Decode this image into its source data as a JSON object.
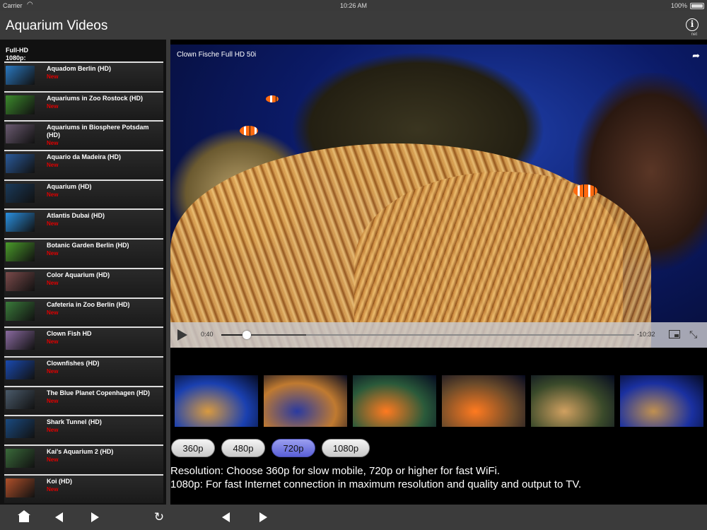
{
  "status": {
    "carrier": "Carrier",
    "time": "10:26 AM",
    "battery": "100%"
  },
  "header": {
    "title": "Aquarium Videos",
    "info_label": "net"
  },
  "sidebar": {
    "section_title": "Full-HD 1080p:",
    "items": [
      {
        "name": "Aquadom Berlin (HD)",
        "badge": "New",
        "thumb": "#2a78c0"
      },
      {
        "name": "Aquariums in Zoo Rostock (HD)",
        "badge": "New",
        "thumb": "#3c8a2c"
      },
      {
        "name": "Aquariums in Biosphere Potsdam (HD)",
        "badge": "New",
        "thumb": "#6a5a70"
      },
      {
        "name": "Aquario da Madeira (HD)",
        "badge": "New",
        "thumb": "#2a5a9a"
      },
      {
        "name": "Aquarium (HD)",
        "badge": "New",
        "thumb": "#1a3a5a"
      },
      {
        "name": "Atlantis Dubai (HD)",
        "badge": "New",
        "thumb": "#2a90e0"
      },
      {
        "name": "Botanic Garden Berlin (HD)",
        "badge": "New",
        "thumb": "#4a9a2a"
      },
      {
        "name": "Color Aquarium (HD)",
        "badge": "New",
        "thumb": "#7a4a4a"
      },
      {
        "name": "Cafeteria in Zoo Berlin (HD)",
        "badge": "New",
        "thumb": "#3a7a3a"
      },
      {
        "name": "Clown Fish HD",
        "badge": "New",
        "thumb": "#8a6aa0"
      },
      {
        "name": "Clownfishes (HD)",
        "badge": "New",
        "thumb": "#1a4ab0"
      },
      {
        "name": "The Blue Planet Copenhagen (HD)",
        "badge": "New",
        "thumb": "#4a5a6a"
      },
      {
        "name": "Shark Tunnel (HD)",
        "badge": "New",
        "thumb": "#1a4a80"
      },
      {
        "name": "Kai's Aquarium 2 (HD)",
        "badge": "New",
        "thumb": "#3a6a3a"
      },
      {
        "name": "Koi (HD)",
        "badge": "New",
        "thumb": "#b0502a"
      }
    ]
  },
  "video": {
    "title": "Clown Fische Full HD 50i",
    "elapsed": "0:40",
    "remaining": "-10:32",
    "progress_fraction": 0.062
  },
  "thumbnails": [
    {
      "color": "#1a40b0",
      "accent": "#d89a40"
    },
    {
      "color": "#c07a30",
      "accent": "#2a3aa0"
    },
    {
      "color": "#2a5a3a",
      "accent": "#ff7a20"
    },
    {
      "color": "#6a4a2a",
      "accent": "#ff7a20"
    },
    {
      "color": "#3a4a2a",
      "accent": "#d0a060"
    },
    {
      "color": "#1a30a0",
      "accent": "#c09050"
    }
  ],
  "resolutions": [
    {
      "label": "360p",
      "active": false
    },
    {
      "label": "480p",
      "active": false
    },
    {
      "label": "720p",
      "active": true
    },
    {
      "label": "1080p",
      "active": false
    }
  ],
  "description": {
    "line1": "Resolution: Choose 360p for slow mobile, 720p or higher for fast WiFi.",
    "line2": "1080p: For fast Internet connection in maximum resolution and quality and output to TV."
  }
}
